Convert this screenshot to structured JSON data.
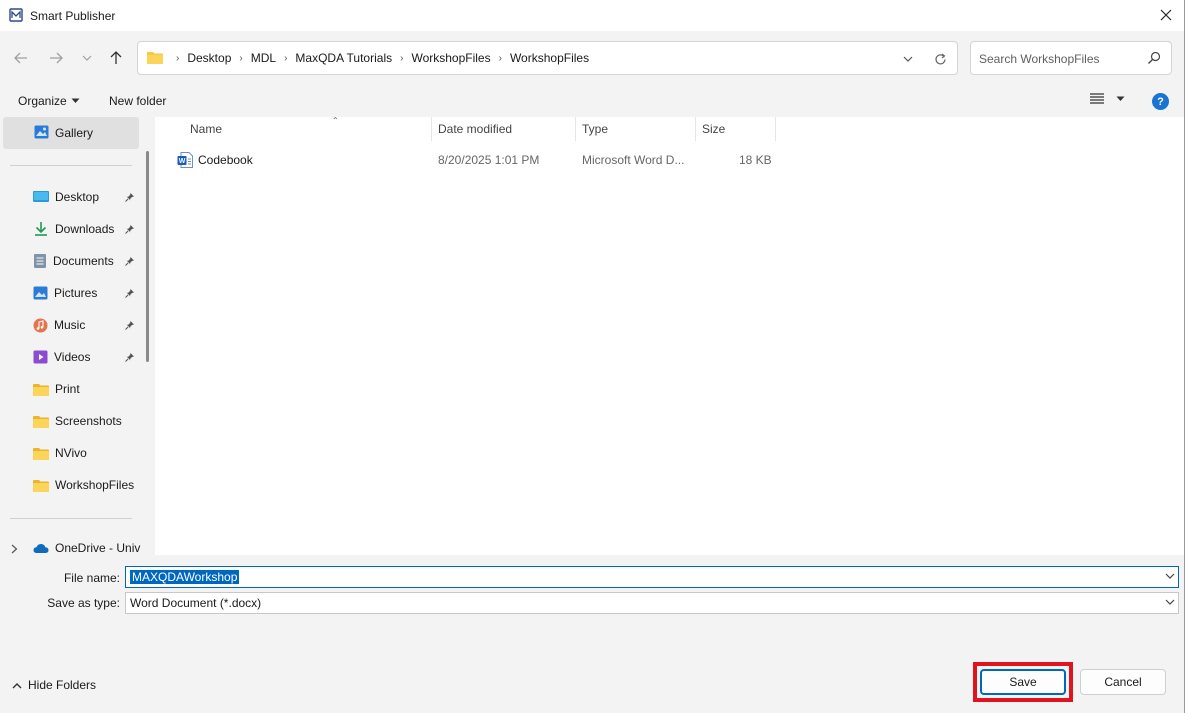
{
  "window": {
    "title": "Smart Publisher",
    "close_icon": "close-icon"
  },
  "nav": {
    "breadcrumbs": [
      "Desktop",
      "MDL",
      "MaxQDA Tutorials",
      "WorkshopFiles",
      "WorkshopFiles"
    ],
    "search_placeholder": "Search WorkshopFiles"
  },
  "toolbar": {
    "organize_label": "Organize",
    "new_folder_label": "New folder",
    "help_label": "?"
  },
  "sidebar": {
    "gallery_label": "Gallery",
    "quick_access": [
      {
        "label": "Desktop",
        "icon": "desktop-icon",
        "pinned": true
      },
      {
        "label": "Downloads",
        "icon": "download-icon",
        "pinned": true
      },
      {
        "label": "Documents",
        "icon": "documents-icon",
        "pinned": true
      },
      {
        "label": "Pictures",
        "icon": "pictures-icon",
        "pinned": true
      },
      {
        "label": "Music",
        "icon": "music-icon",
        "pinned": true
      },
      {
        "label": "Videos",
        "icon": "videos-icon",
        "pinned": true
      },
      {
        "label": "Print",
        "icon": "folder-icon",
        "pinned": false
      },
      {
        "label": "Screenshots",
        "icon": "folder-icon",
        "pinned": false
      },
      {
        "label": "NVivo",
        "icon": "folder-icon",
        "pinned": false
      },
      {
        "label": "WorkshopFiles",
        "icon": "folder-icon",
        "pinned": false
      }
    ],
    "onedrive_label": "OneDrive - Univ"
  },
  "columns": {
    "name": "Name",
    "date_modified": "Date modified",
    "type": "Type",
    "size": "Size"
  },
  "files": [
    {
      "name": "Codebook",
      "date_modified": "8/20/2025 1:01 PM",
      "type": "Microsoft Word D...",
      "size": "18 KB"
    }
  ],
  "form": {
    "file_name_label": "File name:",
    "file_name_value": "MAXQDAWorkshop",
    "save_type_label": "Save as type:",
    "save_type_value": "Word Document (*.docx)"
  },
  "footer": {
    "hide_folders_label": "Hide Folders",
    "save_label": "Save",
    "cancel_label": "Cancel"
  },
  "colors": {
    "accent": "#0067c0",
    "highlight": "#e0141e",
    "folder": "#f7c843"
  }
}
